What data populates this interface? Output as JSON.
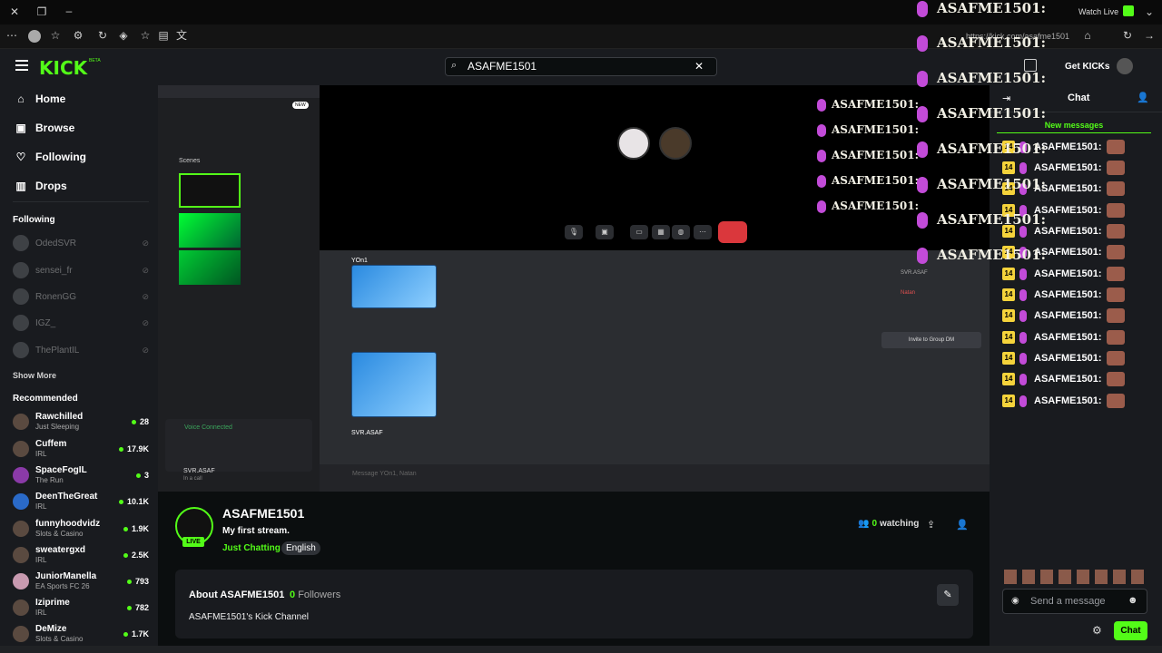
{
  "browser": {
    "url": "https://kick.com/asafme1501",
    "watch_live_label": "Watch Live",
    "tab_title": "ASAFME1501"
  },
  "header": {
    "logo": "KICK",
    "logo_beta": "BETA",
    "search_value": "ASAFME1501",
    "get_kicks_label": "Get KICKs"
  },
  "sidebar": {
    "nav": [
      {
        "label": "Home",
        "icon": "home-icon"
      },
      {
        "label": "Browse",
        "icon": "browse-icon"
      },
      {
        "label": "Following",
        "icon": "heart-icon"
      },
      {
        "label": "Drops",
        "icon": "drops-icon"
      }
    ],
    "following_title": "Following",
    "following": [
      "OdedSVR",
      "sensei_fr",
      "RonenGG",
      "IGZ_",
      "ThePlantIL"
    ],
    "show_more": "Show More",
    "recommended_title": "Recommended",
    "recommended": [
      {
        "name": "Rawchilled",
        "category": "Just Sleeping",
        "viewers": "28"
      },
      {
        "name": "Cuffem",
        "category": "IRL",
        "viewers": "17.9K"
      },
      {
        "name": "SpaceFogIL",
        "category": "The Run",
        "viewers": "3"
      },
      {
        "name": "DeenTheGreat",
        "category": "IRL",
        "viewers": "10.1K"
      },
      {
        "name": "funnyhoodvidz",
        "category": "Slots & Casino",
        "viewers": "1.9K"
      },
      {
        "name": "sweatergxd",
        "category": "IRL",
        "viewers": "2.5K"
      },
      {
        "name": "JuniorManella",
        "category": "EA Sports FC 26",
        "viewers": "793"
      },
      {
        "name": "Iziprime",
        "category": "IRL",
        "viewers": "782"
      },
      {
        "name": "DeMize",
        "category": "Slots & Casino",
        "viewers": "1.7K"
      }
    ]
  },
  "video": {
    "obs_scenes_label": "Scenes",
    "discord_voice_connected": "Voice Connected",
    "discord_user": "SVR.ASAF",
    "discord_user_status": "In a call",
    "discord_msg1_user": "YOn1",
    "discord_msg2_user": "SVR.ASAF",
    "discord_message_placeholder": "Message YOn1, Natan",
    "invite_label": "Invite to Group DM",
    "member_1": "SVR.ASAF",
    "member_2": "Natan",
    "new_badge": "NEW",
    "overlay_name": "ASAFME1501:"
  },
  "channel": {
    "name": "ASAFME1501",
    "live_badge": "LIVE",
    "stream_title": "My first stream.",
    "category": "Just Chatting",
    "language": "English",
    "watching_count": "0",
    "watching_label": "watching",
    "about_title": "About ASAFME1501",
    "followers_count": "0",
    "followers_label": "Followers",
    "about_desc": "ASAFME1501's Kick Channel"
  },
  "chat": {
    "title": "Chat",
    "new_messages": "New messages",
    "badge": "14",
    "messages": [
      "ASAFME1501:",
      "ASAFME1501:",
      "ASAFME1501:",
      "ASAFME1501:",
      "ASAFME1501:",
      "ASAFME1501:",
      "ASAFME1501:",
      "ASAFME1501:",
      "ASAFME1501:",
      "ASAFME1501:",
      "ASAFME1501:",
      "ASAFME1501:",
      "ASAFME1501:"
    ],
    "placeholder": "Send a message",
    "chat_button": "Chat"
  },
  "colors": {
    "kick_green": "#53fc18",
    "background": "#0b0e0f",
    "panel": "#191b1f",
    "sub_badge": "#f5d33b",
    "mic_purple": "#c24bd8"
  }
}
